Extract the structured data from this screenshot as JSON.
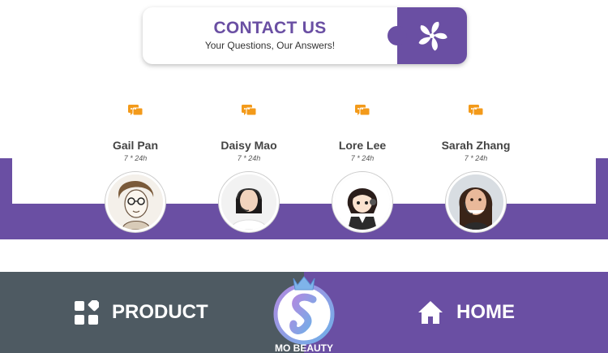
{
  "header": {
    "title": "CONTACT US",
    "subtitle": "Your Questions, Our Answers!",
    "icon": "pinwheel-icon"
  },
  "agents": [
    {
      "name": "Gail Pan",
      "hours": "7 * 24h",
      "icon": "chat-icon"
    },
    {
      "name": "Daisy Mao",
      "hours": "7 * 24h",
      "icon": "chat-icon"
    },
    {
      "name": "Lore Lee",
      "hours": "7 * 24h",
      "icon": "chat-icon"
    },
    {
      "name": "Sarah Zhang",
      "hours": "7 * 24h",
      "icon": "chat-icon"
    }
  ],
  "footer": {
    "product_label": "PRODUCT",
    "home_label": "HOME",
    "logo_text": "MO BEAUTY"
  },
  "colors": {
    "brand_purple": "#6a4fa3",
    "footer_gray": "#4e5a62",
    "chat_orange": "#f39a1a"
  }
}
